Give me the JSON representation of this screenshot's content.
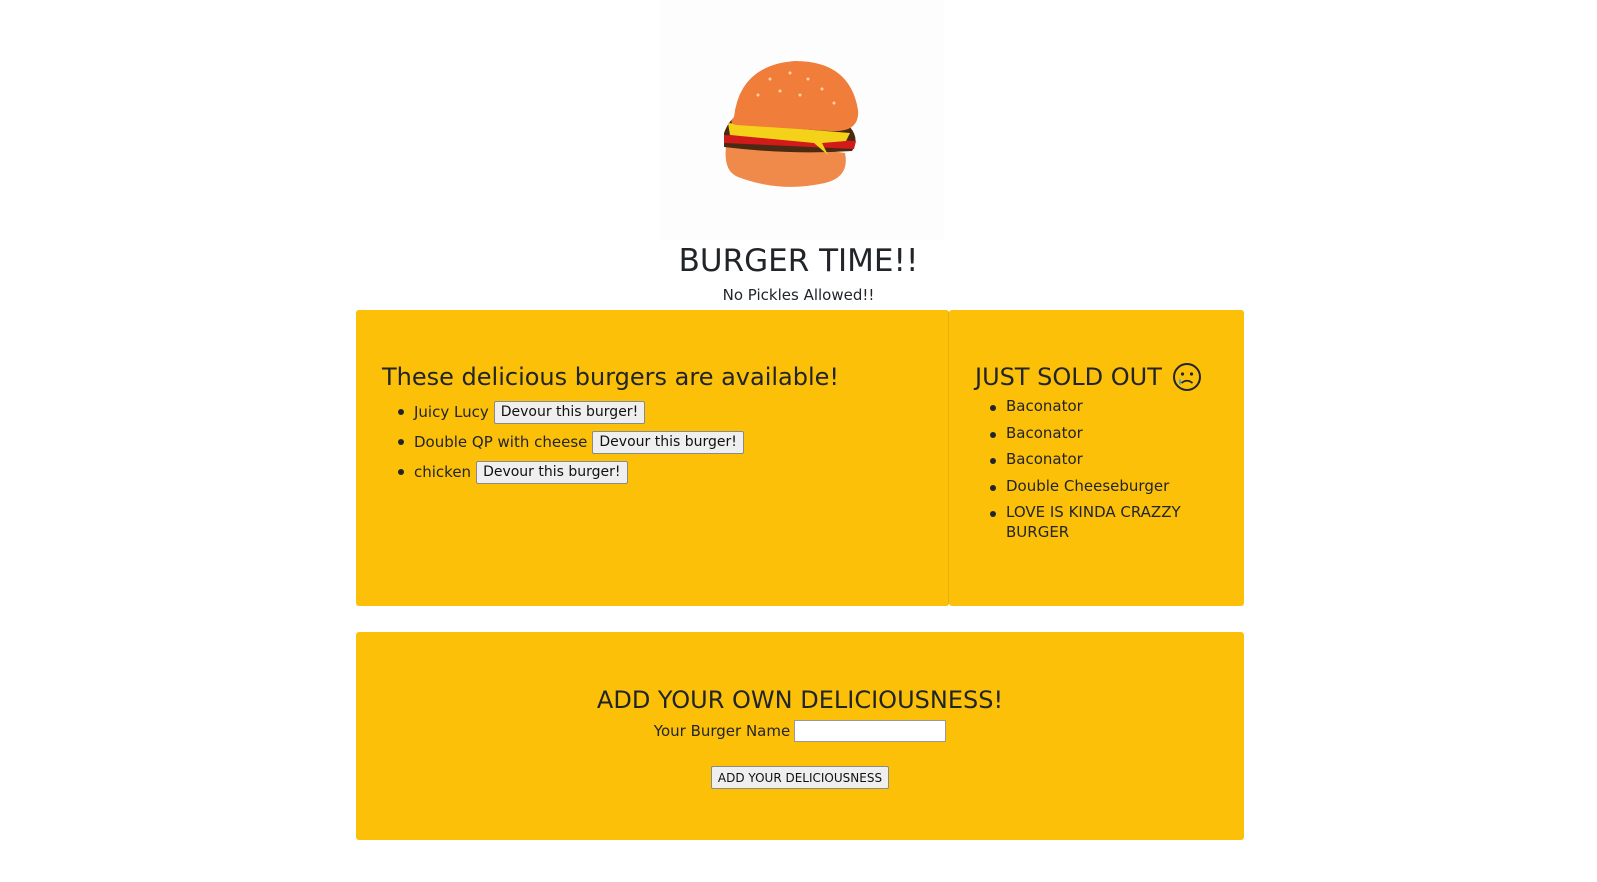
{
  "header": {
    "title": "BURGER TIME!!",
    "subtitle": "No Pickles Allowed!!"
  },
  "available": {
    "heading": "These delicious burgers are available!",
    "button_label": "Devour this burger!",
    "items": [
      "Juicy Lucy",
      "Double QP with cheese",
      "chicken"
    ]
  },
  "sold_out": {
    "heading": "JUST SOLD OUT",
    "icon": "sad-tear-face-icon",
    "items": [
      "Baconator",
      "Baconator",
      "Baconator",
      "Double Cheeseburger",
      "LOVE IS KINDA CRAZZY BURGER"
    ]
  },
  "add_form": {
    "heading": "ADD YOUR OWN DELICIOUSNESS!",
    "label": "Your Burger Name",
    "input_value": "",
    "submit_label": "ADD YOUR DELICIOUSNESS"
  },
  "colors": {
    "panel_bg": "#fcc009",
    "text": "#212529",
    "button_bg": "#efefef"
  }
}
